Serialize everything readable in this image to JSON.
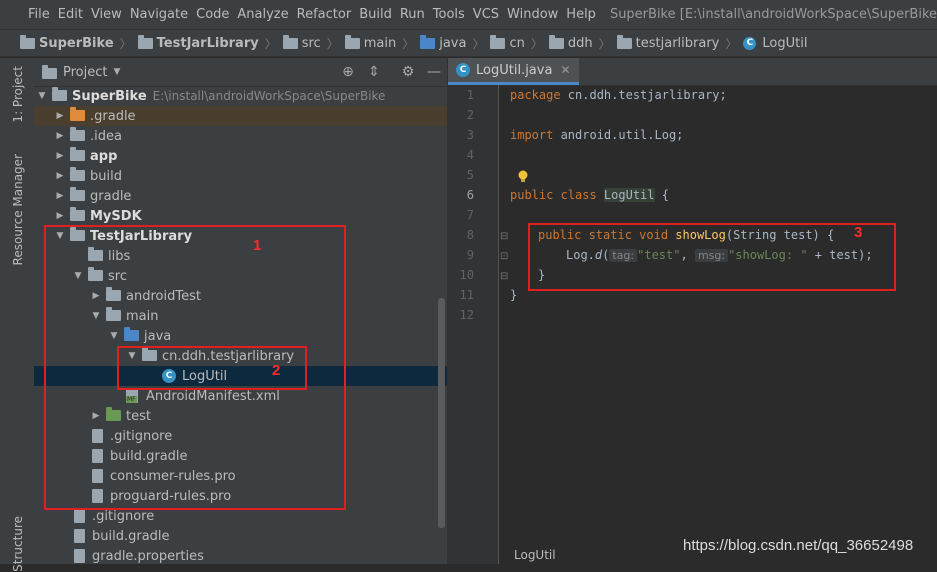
{
  "menubar": {
    "items": [
      "File",
      "Edit",
      "View",
      "Navigate",
      "Code",
      "Analyze",
      "Refactor",
      "Build",
      "Run",
      "Tools",
      "VCS",
      "Window",
      "Help"
    ],
    "window_title": "SuperBike [E:\\install\\androidWorkSpace\\SuperBike]"
  },
  "navbar": {
    "crumbs": [
      "SuperBike",
      "TestJarLibrary",
      "src",
      "main",
      "java",
      "cn",
      "ddh",
      "testjarlibrary",
      "LogUtil"
    ]
  },
  "toolstrip": {
    "project_tab": "1: Project",
    "resource_tab": "Resource Manager",
    "structure_tab": "Structure"
  },
  "project_panel": {
    "title": "Project",
    "tree": [
      {
        "label": "SuperBike",
        "path": "E:\\install\\androidWorkSpace\\SuperBike",
        "icon": "module-folder",
        "expanded": true
      },
      {
        "label": ".gradle",
        "icon": "folder-orange",
        "expanded": false
      },
      {
        "label": ".idea",
        "icon": "folder",
        "expanded": false
      },
      {
        "label": "app",
        "icon": "module-folder",
        "expanded": false
      },
      {
        "label": "build",
        "icon": "folder",
        "expanded": false
      },
      {
        "label": "gradle",
        "icon": "folder",
        "expanded": false
      },
      {
        "label": "MySDK",
        "icon": "module-folder",
        "expanded": false
      },
      {
        "label": "TestJarLibrary",
        "icon": "module-folder",
        "expanded": true
      },
      {
        "label": "libs",
        "icon": "folder"
      },
      {
        "label": "src",
        "icon": "folder",
        "expanded": true
      },
      {
        "label": "androidTest",
        "icon": "folder",
        "expanded": false
      },
      {
        "label": "main",
        "icon": "folder",
        "expanded": true
      },
      {
        "label": "java",
        "icon": "folder-blue",
        "expanded": true
      },
      {
        "label": "cn.ddh.testjarlibrary",
        "icon": "package",
        "expanded": true
      },
      {
        "label": "LogUtil",
        "icon": "class-icon"
      },
      {
        "label": "AndroidManifest.xml",
        "icon": "manifest-icon"
      },
      {
        "label": "test",
        "icon": "folder-green",
        "expanded": false
      },
      {
        "label": ".gitignore",
        "icon": "file-icon"
      },
      {
        "label": "build.gradle",
        "icon": "gradle-icon"
      },
      {
        "label": "consumer-rules.pro",
        "icon": "file-icon"
      },
      {
        "label": "proguard-rules.pro",
        "icon": "file-icon"
      },
      {
        "label": ".gitignore",
        "icon": "file-icon"
      },
      {
        "label": "build.gradle",
        "icon": "gradle-icon"
      },
      {
        "label": "gradle.properties",
        "icon": "file-icon"
      }
    ]
  },
  "editor": {
    "tab_label": "LogUtil.java",
    "line_numbers": [
      "1",
      "2",
      "3",
      "4",
      "5",
      "6",
      "7",
      "8",
      "9",
      "10",
      "11",
      "12"
    ],
    "code": {
      "l1_kw": "package",
      "l1_rest": " cn.ddh.testjarlibrary;",
      "l3_kw": "import",
      "l3_rest": " android.util.Log;",
      "l6_kw": "public class ",
      "l6_cls": "LogUtil",
      "l6_rest": " {",
      "l8_kw": "public static void ",
      "l8_method": "showLog",
      "l8_rest": "(String test) {",
      "l9_a": "Log.",
      "l9_method": "d",
      "l9_b": "(",
      "l9_hint1": "tag:",
      "l9_str1": "\"test\"",
      "l9_c": ", ",
      "l9_hint2": "msg:",
      "l9_str2": "\"showLog: \"",
      "l9_d": " + test);",
      "l10": "}",
      "l11": "}"
    },
    "status_crumb": "LogUtil"
  },
  "annotations": [
    "1",
    "2",
    "3"
  ],
  "watermark": "https://blog.csdn.net/qq_36652498"
}
